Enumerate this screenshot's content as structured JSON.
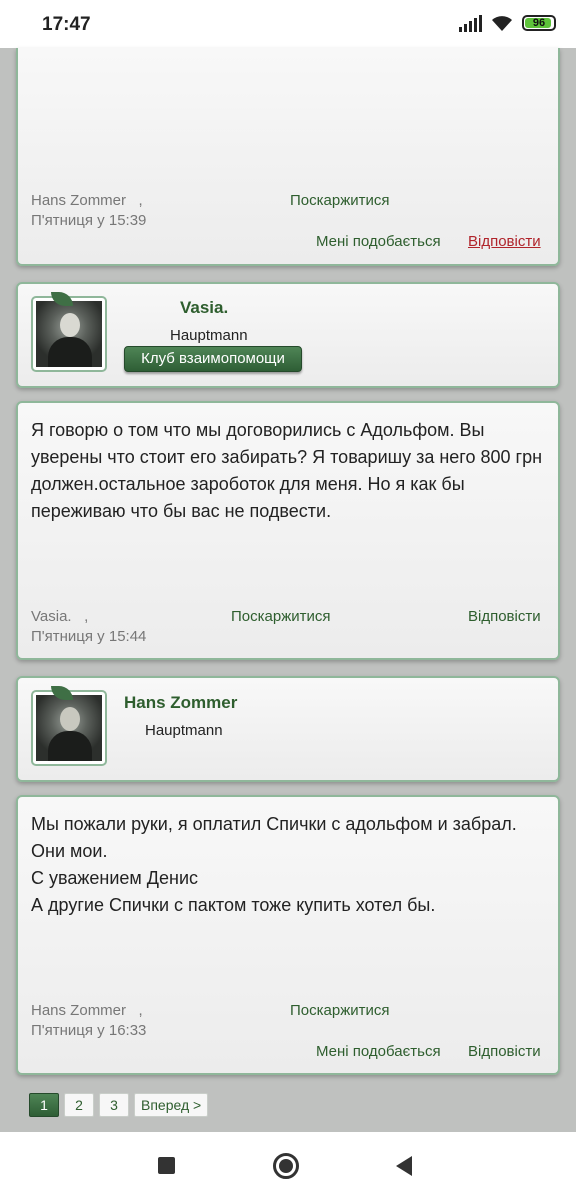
{
  "status_bar": {
    "time": "17:47",
    "battery": "96"
  },
  "posts": [
    {
      "author": "Hans Zommer",
      "separator": ",",
      "date": "П'ятниця у 15:39",
      "report": "Поскаржитися",
      "like": "Мені подобається",
      "reply": "Відповісти"
    },
    {
      "author_card": {
        "name": "Vasia.",
        "rank": "Hauptmann",
        "badge": "Клуб взаимопомощи"
      },
      "text": [
        "Я говорю о том что мы договорились с Адольфом. Вы уверены что стоит его забирать? Я товаришу за него 800 грн должен.остальное зароботок для меня. Но я как бы переживаю что бы вас не подвести."
      ],
      "author": "Vasia.",
      "separator": ",",
      "date": "П'ятниця у 15:44",
      "report": "Поскаржитися",
      "reply": "Відповісти"
    },
    {
      "author_card": {
        "name": "Hans Zommer",
        "rank": "Hauptmann"
      },
      "text": [
        "Мы пожали руки, я оплатил Спички с адольфом и забрал. Они мои.",
        "С уважением Денис",
        "А другие Спички с пактом тоже купить хотел бы."
      ],
      "author": "Hans Zommer",
      "separator": ",",
      "date": "П'ятниця у 16:33",
      "report": "Поскаржитися",
      "like": "Мені подобається",
      "reply": "Відповісти"
    }
  ],
  "pagination": {
    "pages": [
      "1",
      "2",
      "3"
    ],
    "current": "1",
    "next": "Вперед >"
  }
}
